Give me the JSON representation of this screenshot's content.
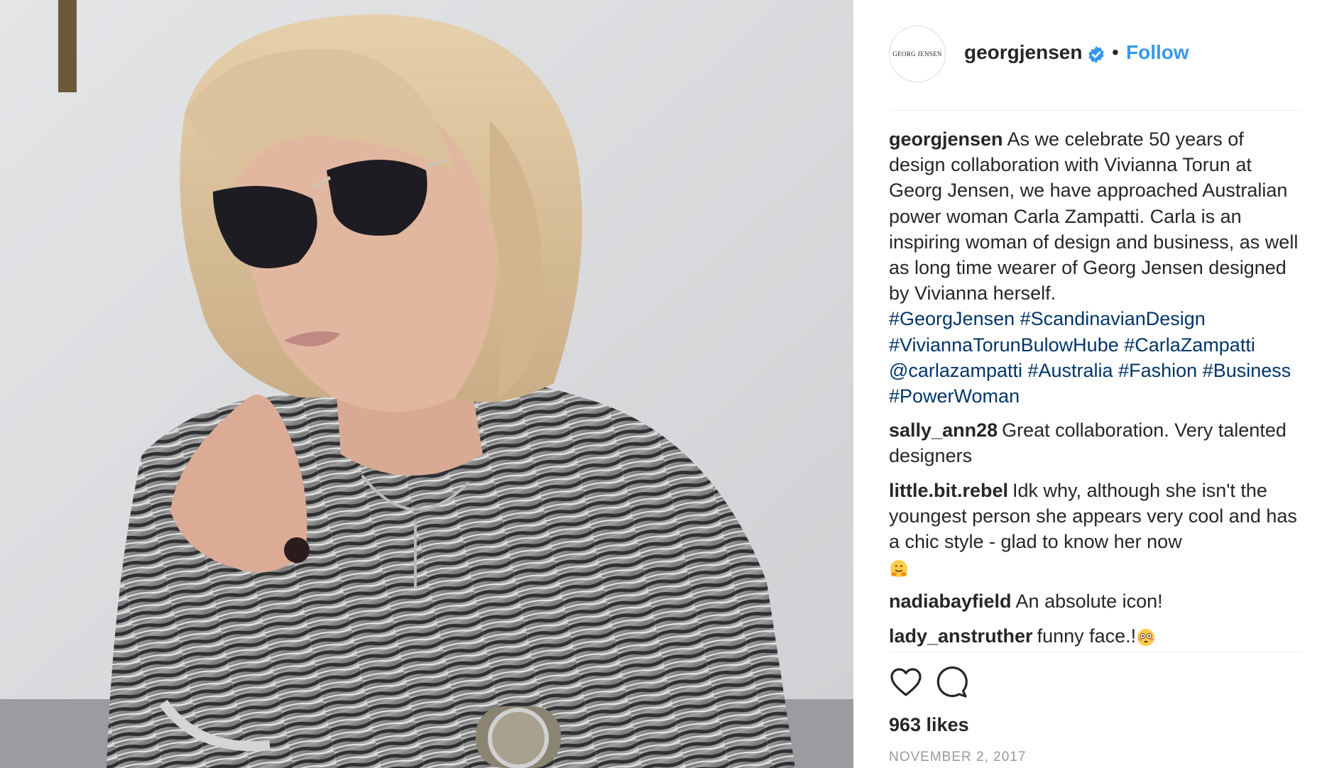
{
  "post": {
    "account": {
      "logo_text": "GEORG JENSEN",
      "username": "georgjensen",
      "separator": "•",
      "follow_label": "Follow",
      "verified_icon": "verified-badge-icon",
      "follow_color": "#3897f0"
    },
    "caption": {
      "username": "georgjensen",
      "text": "As we celebrate 50 years of design collaboration with Vivianna Torun at Georg Jensen, we have approached Australian power woman Carla Zampatti. Carla is an inspiring woman of design and business, as well as long time wearer of Georg Jensen designed by Vivianna herself.",
      "tags": [
        "#GeorgJensen",
        "#ScandinavianDesign",
        "#ViviannaTorunBulowHube",
        "#CarlaZampatti",
        "@carlazampatti",
        "#Australia",
        "#Fashion",
        "#Business",
        "#PowerWoman"
      ],
      "tag_color": "#003569"
    },
    "comments": [
      {
        "username": "sally_ann28",
        "text": "Great collaboration. Very talented designers"
      },
      {
        "username": "little.bit.rebel",
        "text": "Idk why, although she isn't the youngest person she appears very cool and has a chic style - glad to know her now",
        "emoji": "hugging-face-icon"
      },
      {
        "username": "nadiabayfield",
        "text": "An absolute icon!"
      },
      {
        "username": "lady_anstruther",
        "text": "funny face.!",
        "emoji": "flushed-face-icon"
      }
    ],
    "actions": {
      "like_icon": "heart-icon",
      "comment_icon": "comment-icon"
    },
    "likes": "963 likes",
    "date": "NOVEMBER 2, 2017"
  }
}
